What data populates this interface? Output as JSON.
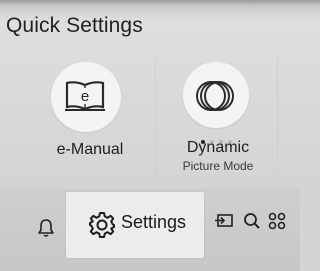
{
  "header": {
    "title": "Quick Settings"
  },
  "tiles": [
    {
      "label": "e-Manual",
      "icon": "e-manual-book-icon"
    },
    {
      "label": "Dynamic",
      "sublabel": "Picture Mode",
      "icon": "picture-mode-icon"
    }
  ],
  "picture_mode_pager": {
    "count": 4,
    "active_index": 0
  },
  "bottom_bar": {
    "settings_label": "Settings",
    "icons": [
      "bell-icon",
      "gear-icon",
      "input-source-icon",
      "search-icon",
      "apps-icon"
    ]
  }
}
